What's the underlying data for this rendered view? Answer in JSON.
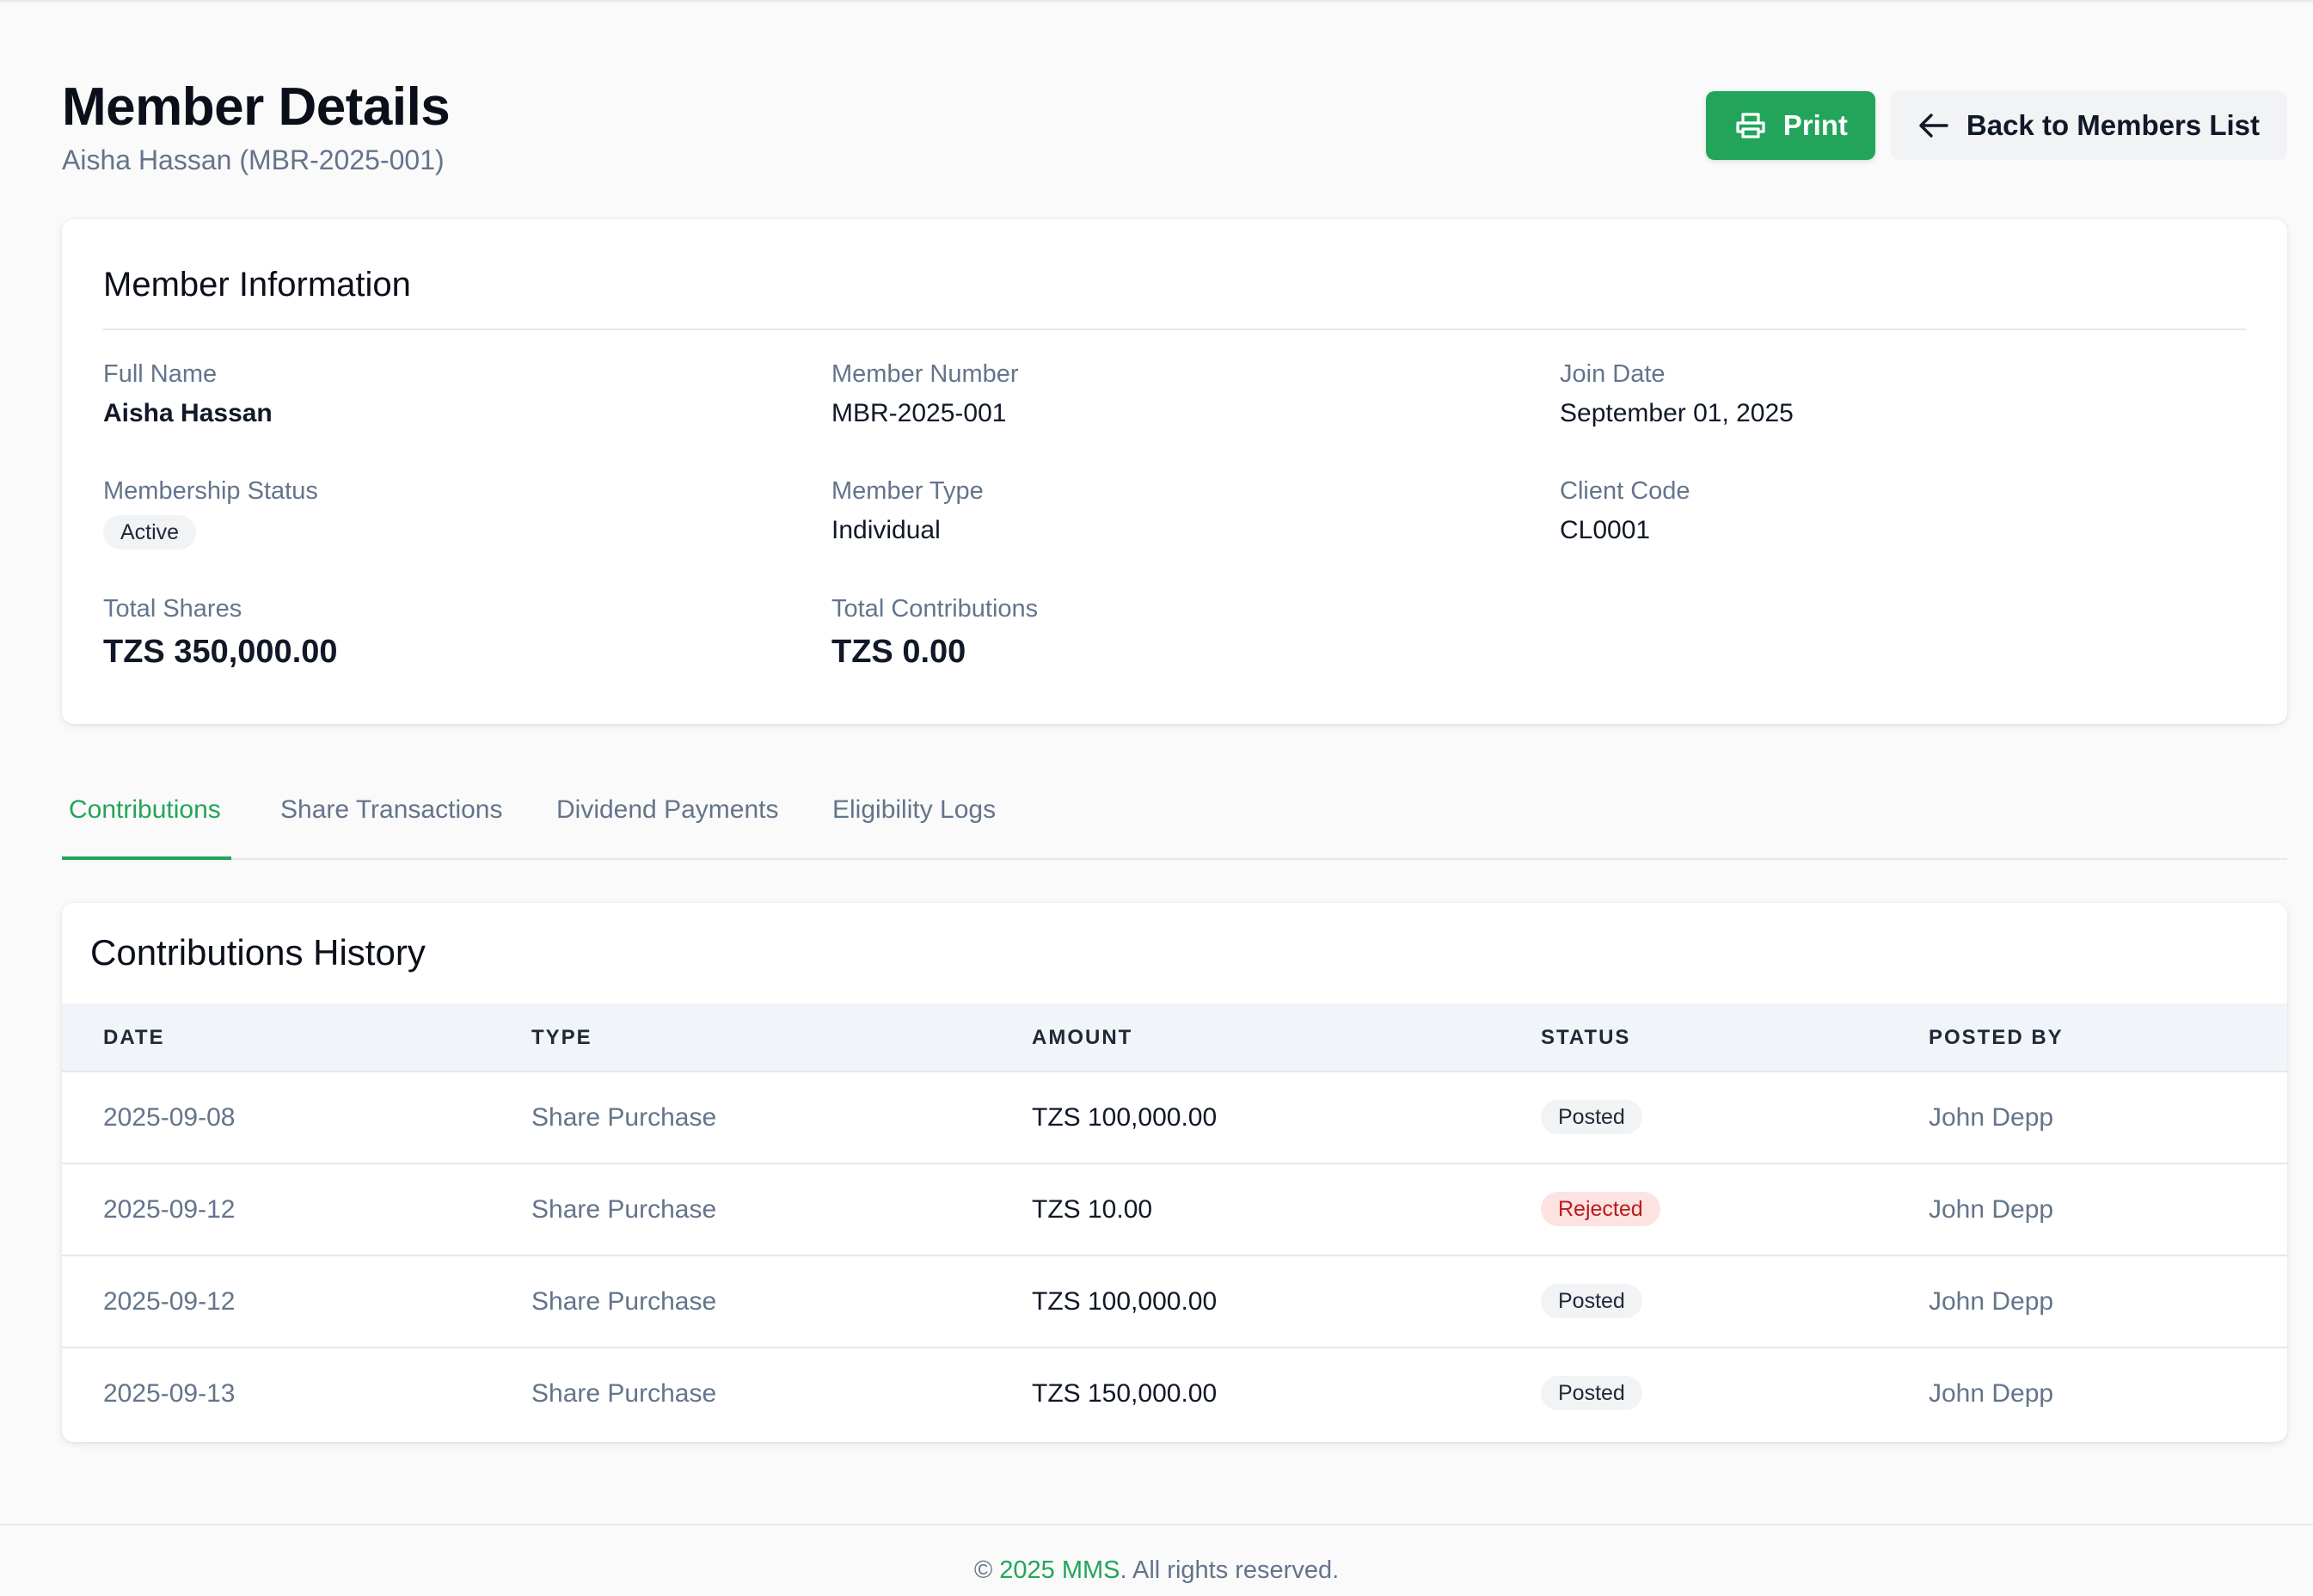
{
  "header": {
    "title": "Member Details",
    "subtitle": "Aisha Hassan (MBR-2025-001)",
    "print_label": "Print",
    "back_label": "Back to Members List"
  },
  "member_info": {
    "title": "Member Information",
    "fields": {
      "full_name": {
        "label": "Full Name",
        "value": "Aisha Hassan"
      },
      "member_number": {
        "label": "Member Number",
        "value": "MBR-2025-001"
      },
      "join_date": {
        "label": "Join Date",
        "value": "September 01, 2025"
      },
      "membership_status": {
        "label": "Membership Status",
        "value": "Active"
      },
      "member_type": {
        "label": "Member Type",
        "value": "Individual"
      },
      "client_code": {
        "label": "Client Code",
        "value": "CL0001"
      },
      "total_shares": {
        "label": "Total Shares",
        "value": "TZS 350,000.00"
      },
      "total_contributions": {
        "label": "Total Contributions",
        "value": "TZS 0.00"
      }
    }
  },
  "tabs": [
    {
      "label": "Contributions",
      "active": true
    },
    {
      "label": "Share Transactions",
      "active": false
    },
    {
      "label": "Dividend Payments",
      "active": false
    },
    {
      "label": "Eligibility Logs",
      "active": false
    }
  ],
  "history": {
    "title": "Contributions History",
    "columns": [
      "DATE",
      "TYPE",
      "AMOUNT",
      "STATUS",
      "POSTED BY"
    ],
    "rows": [
      {
        "date": "2025-09-08",
        "type": "Share Purchase",
        "amount": "TZS 100,000.00",
        "status": "Posted",
        "posted_by": "John Depp"
      },
      {
        "date": "2025-09-12",
        "type": "Share Purchase",
        "amount": "TZS 10.00",
        "status": "Rejected",
        "posted_by": "John Depp"
      },
      {
        "date": "2025-09-12",
        "type": "Share Purchase",
        "amount": "TZS 100,000.00",
        "status": "Posted",
        "posted_by": "John Depp"
      },
      {
        "date": "2025-09-13",
        "type": "Share Purchase",
        "amount": "TZS 150,000.00",
        "status": "Posted",
        "posted_by": "John Depp"
      }
    ]
  },
  "footer": {
    "prefix": "© ",
    "brand": "2025 MMS",
    "suffix": ". All rights reserved."
  },
  "colors": {
    "accent": "#22a55a",
    "rejected_bg": "#fde2e2",
    "rejected_text": "#b91c1c"
  },
  "icons": {
    "print": "printer-icon",
    "back": "arrow-left-icon"
  }
}
